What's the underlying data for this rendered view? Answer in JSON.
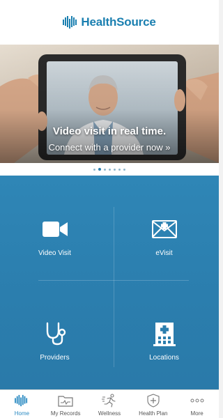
{
  "header": {
    "brand_name": "HealthSource",
    "brand_tm": "..."
  },
  "hero": {
    "title": "Video visit in real time.",
    "subtitle": "Connect with a provider now »",
    "dots_total": 7,
    "dots_active_index": 1
  },
  "tiles": [
    {
      "label": "Video Visit",
      "icon": "video-camera-icon"
    },
    {
      "label": "eVisit",
      "icon": "medical-mail-icon"
    },
    {
      "label": "Providers",
      "icon": "stethoscope-icon"
    },
    {
      "label": "Locations",
      "icon": "hospital-building-icon"
    }
  ],
  "tabbar": [
    {
      "label": "Home",
      "icon": "healthsource-logo-icon",
      "active": true
    },
    {
      "label": "My Records",
      "icon": "records-folder-icon",
      "active": false
    },
    {
      "label": "Wellness",
      "icon": "runner-icon",
      "active": false
    },
    {
      "label": "Health Plan",
      "icon": "shield-plus-icon",
      "active": false
    },
    {
      "label": "More",
      "icon": "more-dots-icon",
      "active": false
    }
  ],
  "colors": {
    "brand": "#1a7fb0",
    "tile_bg": "#2b7eae",
    "tab_active": "#2a8ac2"
  }
}
